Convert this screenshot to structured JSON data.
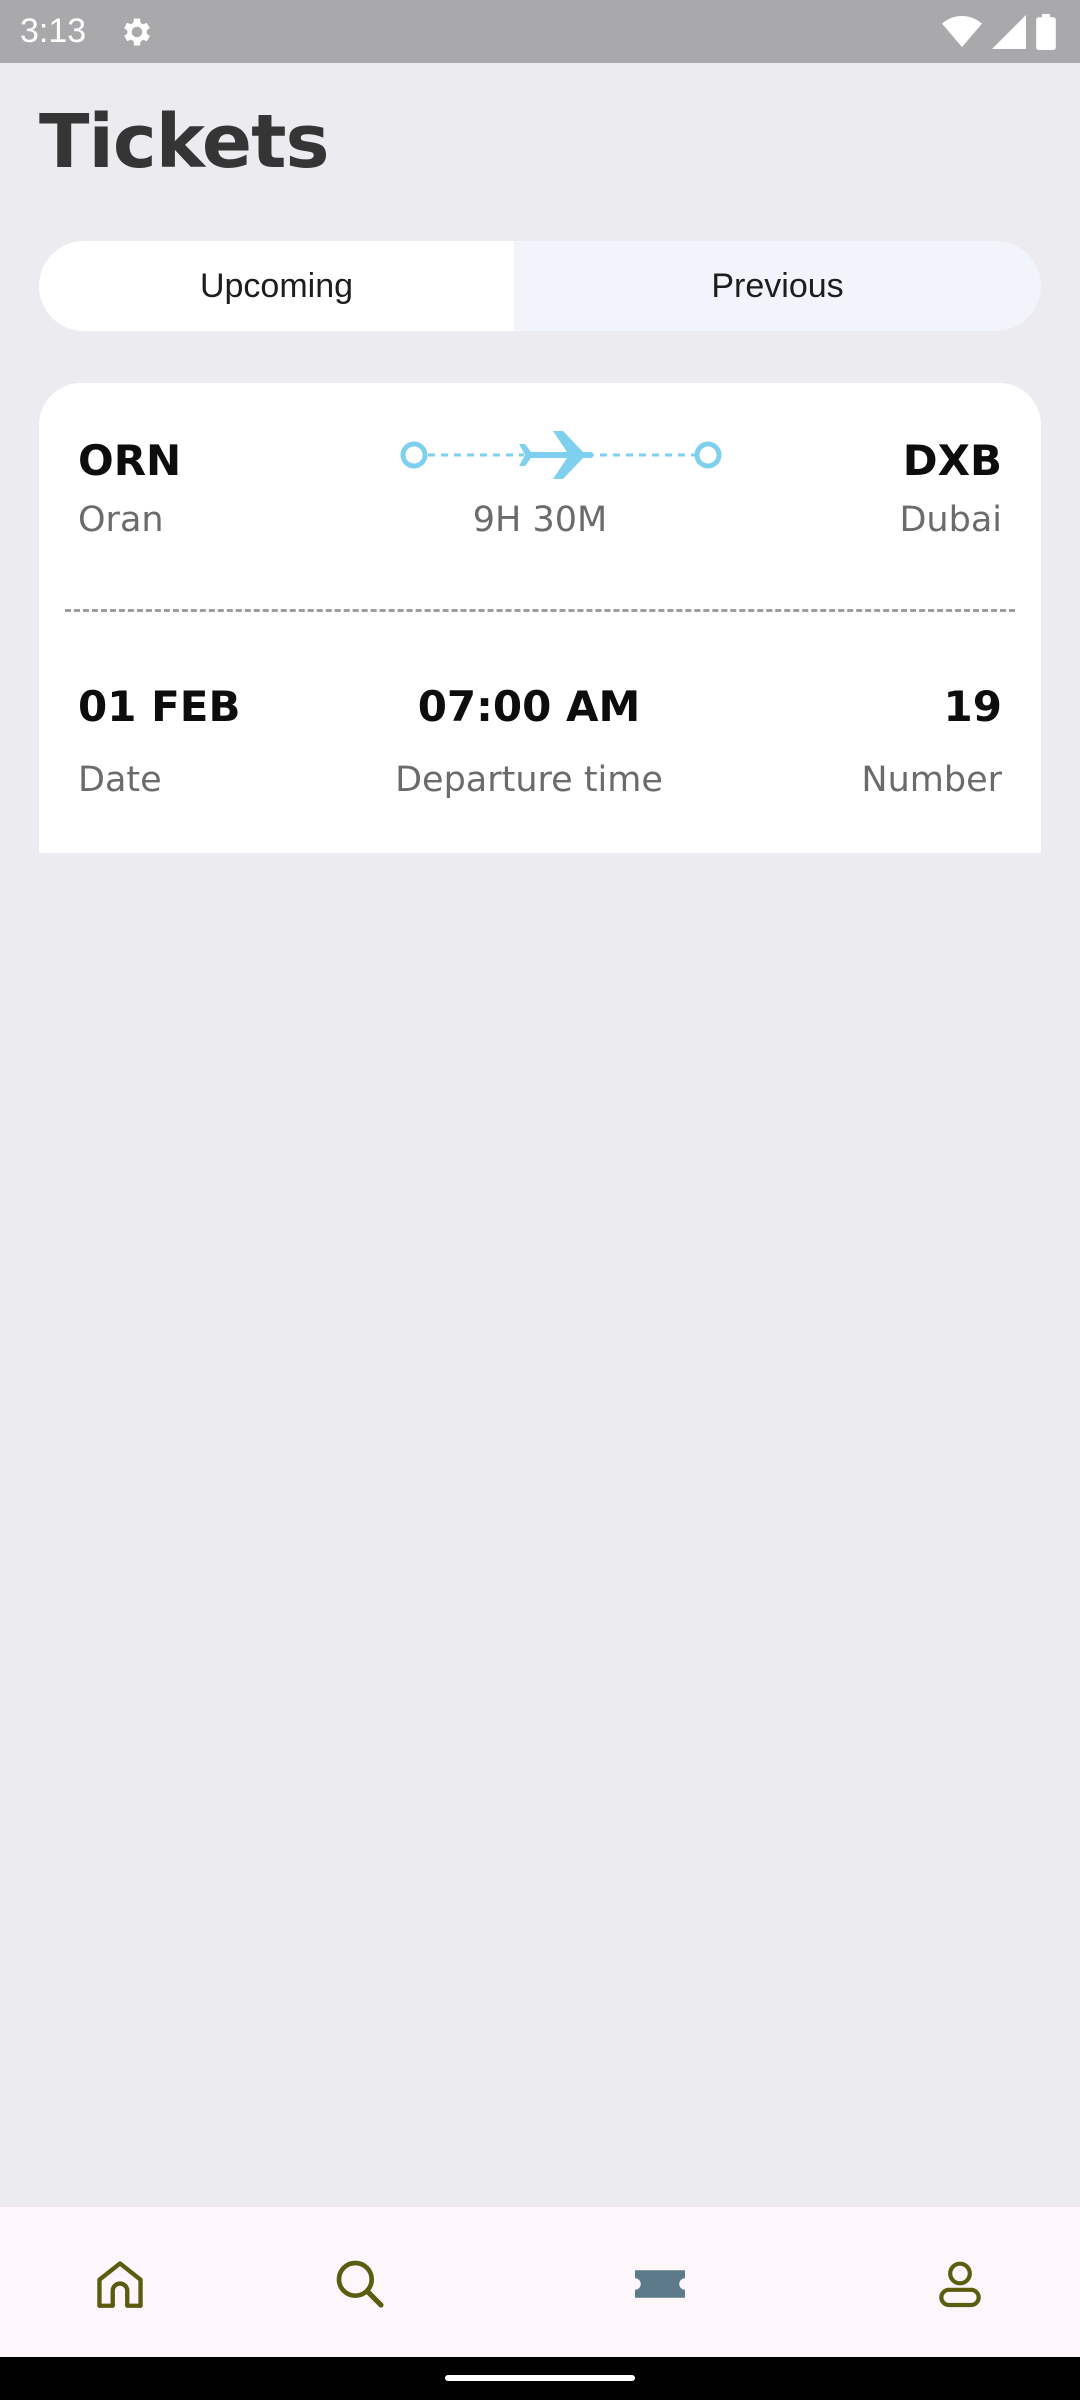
{
  "status_bar": {
    "time": "3:13"
  },
  "header": {
    "title": "Tickets"
  },
  "tabs": [
    {
      "label": "Upcoming",
      "active": true
    },
    {
      "label": "Previous",
      "active": false
    }
  ],
  "ticket": {
    "from_code": "ORN",
    "from_city": "Oran",
    "to_code": "DXB",
    "to_city": "Dubai",
    "duration": "9H 30M",
    "date": "01 FEB",
    "date_label": "Date",
    "departure_time": "07:00 AM",
    "departure_label": "Departure time",
    "number": "19",
    "number_label": "Number"
  },
  "bottom_nav": {
    "items": [
      {
        "icon": "home-icon"
      },
      {
        "icon": "search-icon"
      },
      {
        "icon": "ticket-icon",
        "active": true
      },
      {
        "icon": "profile-icon"
      }
    ]
  },
  "colors": {
    "accent": "#7fd0ef",
    "nav_icon": "#5a5c10",
    "nav_active": "#5b7b8a",
    "background": "#ecebf0"
  }
}
